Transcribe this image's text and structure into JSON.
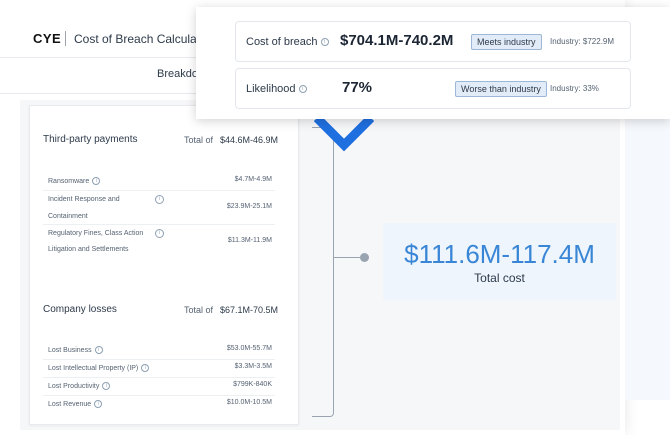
{
  "header": {
    "logo": "CYE",
    "title": "Cost of Breach Calculator"
  },
  "tab": {
    "label": "Breakdown"
  },
  "summary": {
    "cost": {
      "label": "Cost of breach",
      "value": "$704.1M-740.2M",
      "badge": "Meets industry",
      "industry": "Industry: $722.9M"
    },
    "likelihood": {
      "label": "Likelihood",
      "value": "77%",
      "badge": "Worse than industry",
      "industry": "Industry: 33%"
    }
  },
  "breakdown": {
    "third_party": {
      "title": "Third-party payments",
      "total_label": "Total of",
      "total": "$44.6M-46.9M",
      "rows": [
        {
          "label": "Ransomware",
          "value": "$4.7M-4.9M"
        },
        {
          "label": "Incident Response and",
          "label2": "Containment",
          "value": "$23.9M-25.1M"
        },
        {
          "label": "Regulatory Fines, Class Action",
          "label2": "Litigation and Settlements",
          "value": "$11.3M-11.9M"
        }
      ]
    },
    "company_losses": {
      "title": "Company losses",
      "total_label": "Total of",
      "total": "$67.1M-70.5M",
      "rows": [
        {
          "label": "Lost Business",
          "value": "$53.0M-55.7M"
        },
        {
          "label": "Lost Intellectual Property (IP)",
          "value": "$3.3M-3.5M"
        },
        {
          "label": "Lost Productivity",
          "value": "$799K-840K"
        },
        {
          "label": "Lost Revenue",
          "value": "$10.0M-10.5M"
        }
      ]
    }
  },
  "total": {
    "value": "$111.6M-117.4M",
    "label": "Total cost"
  },
  "colors": {
    "accent": "#1f6fe0",
    "total_text": "#3a86d6",
    "badge_bg": "#e2ecf8"
  }
}
